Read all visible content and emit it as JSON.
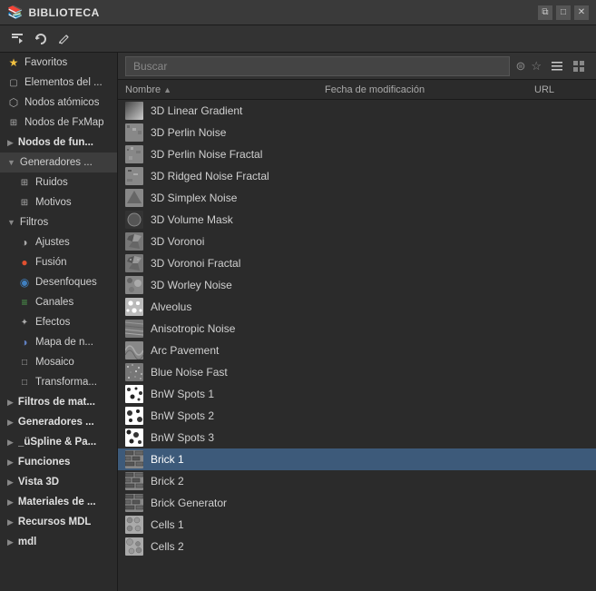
{
  "titleBar": {
    "icon": "📚",
    "title": "BIBLIOTECA",
    "controls": [
      "restore",
      "maximize",
      "close"
    ]
  },
  "toolbar": {
    "buttons": [
      {
        "name": "import-btn",
        "icon": "⬇",
        "label": "Import"
      },
      {
        "name": "refresh-btn",
        "icon": "↻",
        "label": "Refresh"
      },
      {
        "name": "edit-btn",
        "icon": "✏",
        "label": "Edit"
      }
    ]
  },
  "sidebar": {
    "items": [
      {
        "id": "favoritos",
        "label": "Favoritos",
        "icon": "★",
        "iconClass": "star-icon",
        "indent": 0,
        "expandable": false
      },
      {
        "id": "elementos",
        "label": "Elementos del ...",
        "icon": "□",
        "indent": 0,
        "expandable": false
      },
      {
        "id": "nodos-atomicos",
        "label": "Nodos atómicos",
        "icon": "⬡",
        "indent": 0,
        "expandable": false
      },
      {
        "id": "nodos-fxmap",
        "label": "Nodos de FxMap",
        "icon": "⊞",
        "indent": 0,
        "expandable": false
      },
      {
        "id": "nodos-fun",
        "label": "Nodos de fun...",
        "icon": "▶",
        "indent": 0,
        "expandable": true,
        "bold": true
      },
      {
        "id": "generadores",
        "label": "Generadores ...",
        "icon": "▼",
        "indent": 0,
        "expandable": true,
        "active": true
      },
      {
        "id": "ruidos",
        "label": "Ruidos",
        "icon": "⊞",
        "indent": 2,
        "expandable": false
      },
      {
        "id": "motivos",
        "label": "Motivos",
        "icon": "⊞",
        "indent": 2,
        "expandable": false
      },
      {
        "id": "filtros",
        "label": "Filtros",
        "icon": "▼",
        "indent": 0,
        "expandable": true
      },
      {
        "id": "ajustes",
        "label": "Ajustes",
        "icon": "◑",
        "indent": 2,
        "expandable": false
      },
      {
        "id": "fusion",
        "label": "Fusión",
        "icon": "●",
        "indent": 2,
        "expandable": false
      },
      {
        "id": "desenfoques",
        "label": "Desenfoques",
        "icon": "◉",
        "indent": 2,
        "expandable": false
      },
      {
        "id": "canales",
        "label": "Canales",
        "icon": "≡",
        "indent": 2,
        "expandable": false
      },
      {
        "id": "efectos",
        "label": "Efectos",
        "icon": "✦",
        "indent": 2,
        "expandable": false
      },
      {
        "id": "mapa-n",
        "label": "Mapa de n...",
        "icon": "◑",
        "indent": 2,
        "expandable": false
      },
      {
        "id": "mosaico",
        "label": "Mosaico",
        "icon": "□",
        "indent": 2,
        "expandable": false
      },
      {
        "id": "transforma",
        "label": "Transforma...",
        "icon": "□",
        "indent": 2,
        "expandable": false
      },
      {
        "id": "filtros-mat",
        "label": "Filtros de mat...",
        "icon": "▶",
        "indent": 0,
        "expandable": true,
        "bold": true
      },
      {
        "id": "generadores2",
        "label": "Generadores ...",
        "icon": "▶",
        "indent": 0,
        "expandable": true,
        "bold": true
      },
      {
        "id": "uspline",
        "label": "_üSpline & Pa...",
        "icon": "▶",
        "indent": 0,
        "expandable": true,
        "bold": true
      },
      {
        "id": "funciones",
        "label": "Funciones",
        "icon": "▶",
        "indent": 0,
        "expandable": true,
        "bold": true
      },
      {
        "id": "vista3d",
        "label": "Vista 3D",
        "icon": "▶",
        "indent": 0,
        "expandable": true,
        "bold": true
      },
      {
        "id": "materiales",
        "label": "Materiales de ...",
        "icon": "▶",
        "indent": 0,
        "expandable": true,
        "bold": true
      },
      {
        "id": "recursos-mdl",
        "label": "Recursos MDL",
        "icon": "▶",
        "indent": 0,
        "expandable": true,
        "bold": true
      },
      {
        "id": "mdl",
        "label": "mdl",
        "icon": "▶",
        "indent": 0,
        "expandable": true,
        "bold": true
      }
    ]
  },
  "searchBar": {
    "placeholder": "Buscar",
    "filterIcon": "⊜",
    "starIcon": "☆",
    "listViewIcon": "≡",
    "gridViewIcon": "⊞"
  },
  "tableHeader": {
    "nameLabel": "Nombre",
    "nameSortIcon": "▲",
    "dateLabel": "Fecha de modificación",
    "urlLabel": "URL"
  },
  "items": [
    {
      "id": "3d-linear-gradient",
      "name": "3D Linear Gradient",
      "thumbType": "gray"
    },
    {
      "id": "3d-perlin-noise",
      "name": "3D Perlin Noise",
      "thumbType": "gray"
    },
    {
      "id": "3d-perlin-noise-fractal",
      "name": "3D Perlin Noise Fractal",
      "thumbType": "gray"
    },
    {
      "id": "3d-ridged-noise-fractal",
      "name": "3D Ridged Noise Fractal",
      "thumbType": "gray"
    },
    {
      "id": "3d-simplex-noise",
      "name": "3D Simplex Noise",
      "thumbType": "gray"
    },
    {
      "id": "3d-volume-mask",
      "name": "3D Volume Mask",
      "thumbType": "gray-dark"
    },
    {
      "id": "3d-voronoi",
      "name": "3D Voronoi",
      "thumbType": "gray"
    },
    {
      "id": "3d-voronoi-fractal",
      "name": "3D Voronoi Fractal",
      "thumbType": "gray"
    },
    {
      "id": "3d-worley-noise",
      "name": "3D Worley Noise",
      "thumbType": "gray"
    },
    {
      "id": "alveolus",
      "name": "Alveolus",
      "thumbType": "white-circle"
    },
    {
      "id": "anisotropic-noise",
      "name": "Anisotropic Noise",
      "thumbType": "gray"
    },
    {
      "id": "arc-pavement",
      "name": "Arc Pavement",
      "thumbType": "gray"
    },
    {
      "id": "blue-noise-fast",
      "name": "Blue Noise Fast",
      "thumbType": "gray"
    },
    {
      "id": "bnw-spots-1",
      "name": "BnW Spots 1",
      "thumbType": "white-spots"
    },
    {
      "id": "bnw-spots-2",
      "name": "BnW Spots 2",
      "thumbType": "white-spots"
    },
    {
      "id": "bnw-spots-3",
      "name": "BnW Spots 3",
      "thumbType": "white-spots"
    },
    {
      "id": "brick-1",
      "name": "Brick 1",
      "thumbType": "brick",
      "selected": true
    },
    {
      "id": "brick-2",
      "name": "Brick 2",
      "thumbType": "brick"
    },
    {
      "id": "brick-generator",
      "name": "Brick Generator",
      "thumbType": "brick"
    },
    {
      "id": "cells-1",
      "name": "Cells 1",
      "thumbType": "cells"
    },
    {
      "id": "cells-2",
      "name": "Cells 2",
      "thumbType": "cells"
    }
  ],
  "colors": {
    "bg": "#2b2b2b",
    "sidebar-bg": "#2b2b2b",
    "header-bg": "#3a3a3a",
    "toolbar-bg": "#333",
    "selected-bg": "#3d5a7a",
    "border": "#1a1a1a",
    "text-primary": "#d0d0d0",
    "text-secondary": "#aaa",
    "star": "#f0c040"
  }
}
